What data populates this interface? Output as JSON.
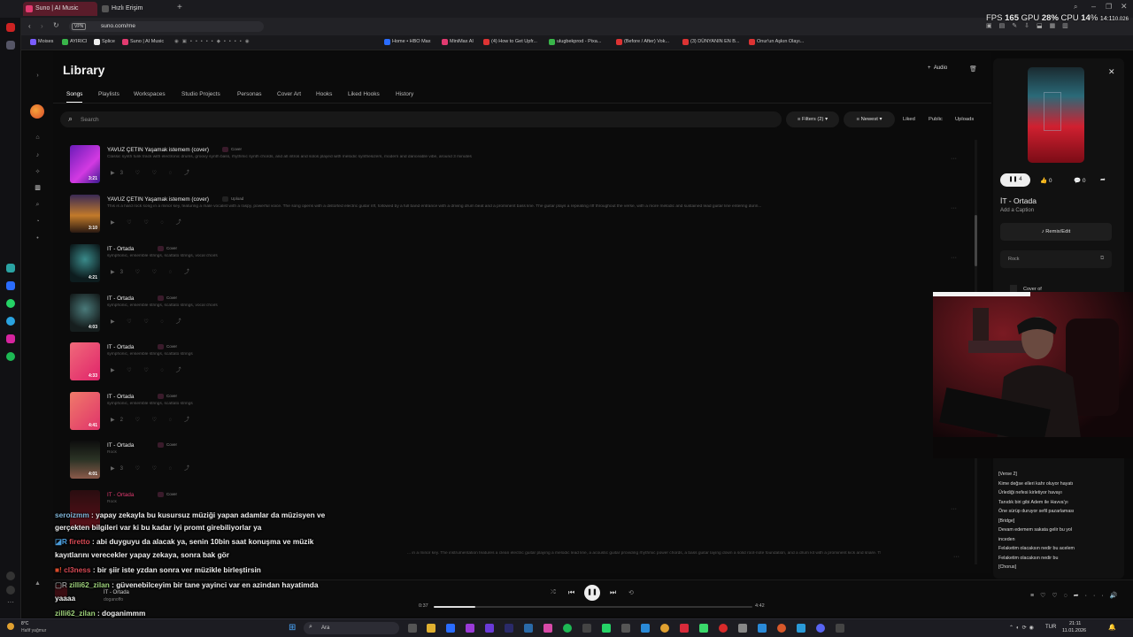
{
  "browser": {
    "tabs": [
      {
        "label": "Suno | AI Music",
        "active": true
      },
      {
        "label": "Hızlı Erişim",
        "active": false
      }
    ],
    "vpn_label": "VPN",
    "url": "suno.com/me",
    "bookmarks": [
      "Moises",
      "AYIRICI",
      "Splice",
      "Suno | AI Music",
      "Home • HBO Max",
      "MiniMax AI",
      "(4) How to Get Upfr...",
      "ulugbekprod - Pixa...",
      "(Before / After) Vok...",
      "(3) DÜNYANIN EN B...",
      "Onur'un Aşkın Olayı..."
    ]
  },
  "osd": {
    "fps_label": "FPS",
    "fps": "165",
    "gpu_label": "GPU",
    "gpu": "28",
    "cpu_label": "CPU",
    "cpu": "14",
    "pct": "%",
    "time": "14:11",
    "time_suffix": "0.026"
  },
  "page": {
    "title": "Library",
    "add_audio": "Audio",
    "tabs": [
      "Songs",
      "Playlists",
      "Workspaces",
      "Studio Projects",
      "Personas",
      "Cover Art",
      "Hooks",
      "Liked Hooks",
      "History"
    ],
    "search_placeholder": "Search",
    "filters": "Filters (2)",
    "sort": "Newest",
    "toggles": [
      "Liked",
      "Public",
      "Uploads"
    ]
  },
  "songs": [
    {
      "title": "YAVUZ ÇETIN Yaşamak istemem (cover)",
      "badge": "Cover",
      "desc": "Classic synth funk track with electronic drums, groovy synth bass, rhythmic synth chords, and all intros and solos played with melodic synthesizers, modern and danceable vibe, around 3 minutes",
      "duration": "3:21",
      "plays": "3",
      "color": "#8a2be2"
    },
    {
      "title": "YAVUZ ÇETIN Yaşamak istemem (cover)",
      "badge": "Upload",
      "desc": "This is a hard rock song in a minor key, featuring a male vocalist with a raspy, powerful voice. The song opens with a distorted electric guitar riff, followed by a full band entrance with a driving drum beat and a prominent bass line. The guitar plays a repeating riff throughout the verse, with a more melodic and sustained lead guitar line entering durin...",
      "duration": "3:10",
      "plays": "",
      "color": "#c27a2a"
    },
    {
      "title": "IT - Ortada",
      "badge": "Cover",
      "desc": "symphonic, ensemble strings, scattato strings, vocal choirs",
      "duration": "4:21",
      "plays": "3",
      "color": "#1b3b3f"
    },
    {
      "title": "IT - Ortada",
      "badge": "Cover",
      "desc": "symphonic, ensemble strings, scattato strings, vocal choirs",
      "duration": "4:03",
      "plays": "",
      "color": "#2a3b3d"
    },
    {
      "title": "IT - Ortada",
      "badge": "Cover",
      "desc": "symphonic, ensemble strings, scattato strings",
      "duration": "4:33",
      "plays": "",
      "color": "#e23a70"
    },
    {
      "title": "IT - Ortada",
      "badge": "Cover",
      "desc": "symphonic, ensemble strings, scattato strings",
      "duration": "4:41",
      "plays": "2",
      "color": "#e04a6a"
    },
    {
      "title": "IT - Ortada",
      "badge": "Cover",
      "desc": "Rock",
      "duration": "4:01",
      "plays": "3",
      "color": "#2b3325"
    },
    {
      "title": "IT - Ortada",
      "badge": "Cover",
      "desc": "Rock",
      "duration": "",
      "plays": "",
      "color": "#3a0d12"
    }
  ],
  "hidden_desc": "... in a minor key. The instrumentation features a clean electric guitar playing a melodic lead line, a acoustic guitar providing rhythmic power chords, a bass guitar laying down a solid root-note foundation, and a drum kit with a prominent kick and snare. The male lead vocalist si...",
  "panel": {
    "song_title": "İT - Ortada",
    "caption": "Add a Caption",
    "likes": "0",
    "comments": "0",
    "plays": "4",
    "remix": "Remix/Edit",
    "style_tag": "Rock",
    "cover_of": "Cover of"
  },
  "lyrics": [
    "[Verse 2]",
    "Kime değse elleri kahr oluyor hayatı",
    "Ürlediği nefesi kirletiyor havayı",
    "Tanıdık biri gibi Adem ile Havva'yı",
    "Öne sürüp duruyor sefil pazarlaması",
    "[Bridge]",
    "Devam edemem sakata gelir bu yol",
    "inceden",
    "Felaketim olacaksın nedir bu acelem",
    "Felaketim olacaksın nedir bu",
    "[Chorus]"
  ],
  "chat": [
    {
      "user": "seroizmm",
      "text": "yapay zekayla bu kusursuz müziği yapan adamlar da müzisyen ve",
      "cont": "gerçekten bilgileri var ki bu kadar iyi promt girebiliyorlar ya"
    },
    {
      "user": "firetto",
      "text": "abi duyguyu da alacak ya, senin 10bin saat konuşma ve müzik",
      "cont": "kayıtlarını verecekler yapay zekaya, sonra bak gör"
    },
    {
      "user": "cl3ness",
      "text": "bir şiir iste yzdan sonra ver müzikle birleştirsin",
      "cont": ""
    },
    {
      "user": "zilli62_zilan",
      "text": "güvenebilceyim bir tane yayinci var en azindan hayatimda",
      "cont": "yaaaa"
    },
    {
      "user": "zilli62_zilan",
      "text": "doganimmm",
      "cont": ""
    },
    {
      "user": "firetto",
      "text": "",
      "cont": ""
    }
  ],
  "player": {
    "track": "İT - Ortada",
    "artist": "doganoffo",
    "elapsed": "0:37",
    "total": "4:42",
    "progress": 0.13
  },
  "taskbar": {
    "weather_temp": "8°C",
    "weather_desc": "Hafif yağmur",
    "search": "Ara",
    "lang": "TUR",
    "clock": "21:11",
    "date": "11.01.2026"
  },
  "colors": {
    "accent": "#e23a70",
    "bg": "#0b0b0b"
  }
}
